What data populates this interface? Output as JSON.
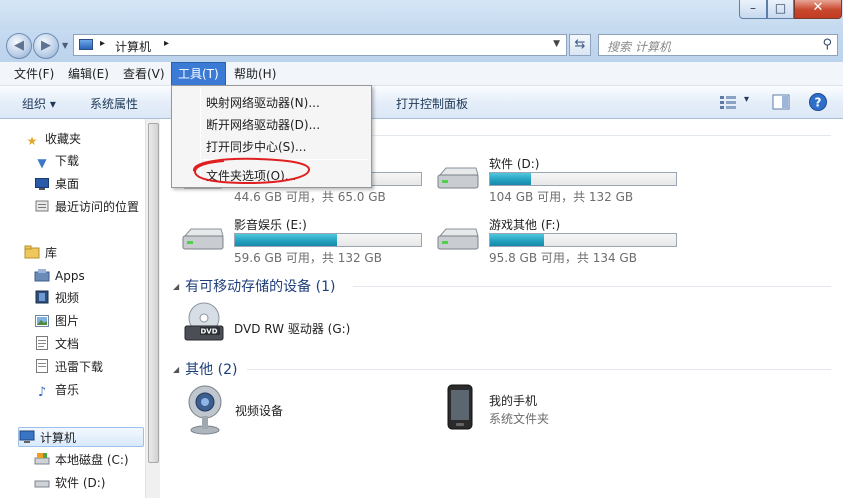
{
  "window": {
    "controls": {
      "minimize": "–",
      "maximize": "□",
      "close": "✕"
    }
  },
  "address": {
    "crumb": "计算机",
    "separator": "▸",
    "search_placeholder": "搜索 计算机"
  },
  "menubar": {
    "items": [
      "文件(F)",
      "编辑(E)",
      "查看(V)",
      "工具(T)",
      "帮助(H)"
    ],
    "active_index": 3
  },
  "toolbar": {
    "organize": "组织 ▾",
    "system_properties": "系统属性",
    "control_panel": "打开控制面板",
    "views_dropdown": "▾",
    "help": "?"
  },
  "tools_menu": {
    "items": [
      "映射网络驱动器(N)...",
      "断开网络驱动器(D)...",
      "打开同步中心(S)...",
      "文件夹选项(O)..."
    ]
  },
  "nav": {
    "favorites_header": "收藏夹",
    "favorites": [
      "下载",
      "桌面",
      "最近访问的位置"
    ],
    "libraries_header": "库",
    "libraries": [
      "Apps",
      "视频",
      "图片",
      "文档",
      "迅雷下载",
      "音乐"
    ],
    "computer_header": "计算机",
    "computer": [
      "本地磁盘 (C:)",
      "软件 (D:)"
    ]
  },
  "content": {
    "hard_drives": [
      {
        "name": "",
        "size": "44.6 GB 可用，共 65.0 GB",
        "used": 0.31
      },
      {
        "name": "软件 (D:)",
        "size": "104 GB 可用，共 132 GB",
        "used": 0.22
      },
      {
        "name": "影音娱乐 (E:)",
        "size": "59.6 GB 可用，共 132 GB",
        "used": 0.55
      },
      {
        "name": "游戏其他 (F:)",
        "size": "95.8 GB 可用，共 134 GB",
        "used": 0.29
      }
    ],
    "removable_header": "有可移动存储的设备 (1)",
    "removable": [
      {
        "name": "DVD RW 驱动器 (G:)"
      }
    ],
    "other_header": "其他 (2)",
    "other": [
      {
        "name": "视频设备",
        "sub": ""
      },
      {
        "name": "我的手机",
        "sub": "系统文件夹"
      }
    ]
  },
  "colors": {
    "menu_active": "#3b7bd6",
    "drive_bar": "#26a2c1",
    "group_header": "#1e3f7c",
    "highlight_circle": "#e02020"
  }
}
